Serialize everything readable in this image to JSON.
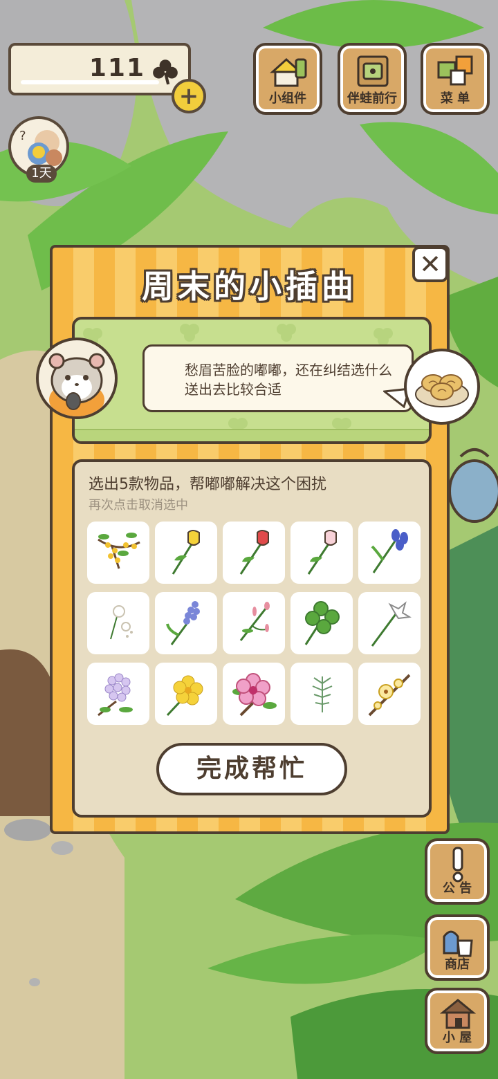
{
  "hud": {
    "clover_count": "111",
    "plus_symbol": "+",
    "day_badge": "1天"
  },
  "top_buttons": [
    {
      "label": "小组件"
    },
    {
      "label": "伴蛙前行"
    },
    {
      "label": "菜 单"
    }
  ],
  "side_buttons": [
    {
      "label": "公 告"
    },
    {
      "label": "商店"
    },
    {
      "label": "小 屋"
    }
  ],
  "modal": {
    "title": "周末的小插曲",
    "close_symbol": "✕",
    "story_text": "愁眉苦脸的嘟嘟，还在纠结选什么送出去比较合适",
    "instruction": "选出5款物品，帮嘟嘟解决这个困扰",
    "hint": "再次点击取消选中",
    "done_label": "完成帮忙",
    "items": [
      {
        "icon": "osmanthus-icon"
      },
      {
        "icon": "yellow-tulip-icon"
      },
      {
        "icon": "red-tulip-icon"
      },
      {
        "icon": "pink-tulip-icon"
      },
      {
        "icon": "iris-icon"
      },
      {
        "icon": "dandelion-icon"
      },
      {
        "icon": "hyacinth-icon"
      },
      {
        "icon": "pink-sprig-icon"
      },
      {
        "icon": "four-leaf-clover-icon"
      },
      {
        "icon": "lily-icon"
      },
      {
        "icon": "lilac-icon"
      },
      {
        "icon": "buttercup-icon"
      },
      {
        "icon": "hibiscus-icon"
      },
      {
        "icon": "herb-sprig-icon"
      },
      {
        "icon": "wintersweet-icon"
      }
    ]
  },
  "colors": {
    "outline": "#4e3e30",
    "modal_stripe_a": "#f6b744",
    "modal_stripe_b": "#f9cc6b",
    "story_bg": "#c7df8f",
    "panel_bg": "#e8ddc3",
    "button_wood": "#d8a867"
  }
}
